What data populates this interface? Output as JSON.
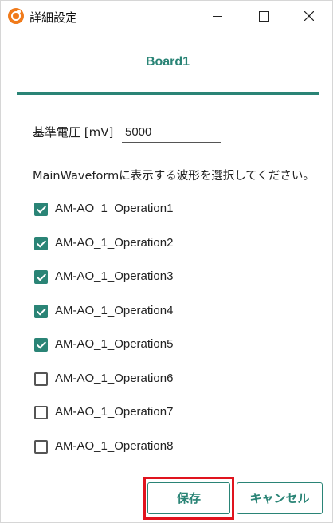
{
  "window": {
    "title": "詳細設定",
    "icon": "app-logo-icon"
  },
  "board": {
    "tab_label": "Board1",
    "accent_color": "#2a8476"
  },
  "voltage": {
    "label": "基準電圧 [mV]",
    "value": "5000"
  },
  "instruction": "MainWaveformに表示する波形を選択してください。",
  "waveforms": [
    {
      "label": "AM-AO_1_Operation1",
      "checked": true
    },
    {
      "label": "AM-AO_1_Operation2",
      "checked": true
    },
    {
      "label": "AM-AO_1_Operation3",
      "checked": true
    },
    {
      "label": "AM-AO_1_Operation4",
      "checked": true
    },
    {
      "label": "AM-AO_1_Operation5",
      "checked": true
    },
    {
      "label": "AM-AO_1_Operation6",
      "checked": false
    },
    {
      "label": "AM-AO_1_Operation7",
      "checked": false
    },
    {
      "label": "AM-AO_1_Operation8",
      "checked": false
    }
  ],
  "buttons": {
    "save_label": "保存",
    "cancel_label": "キャンセル"
  },
  "highlight_color": "#e0141e"
}
